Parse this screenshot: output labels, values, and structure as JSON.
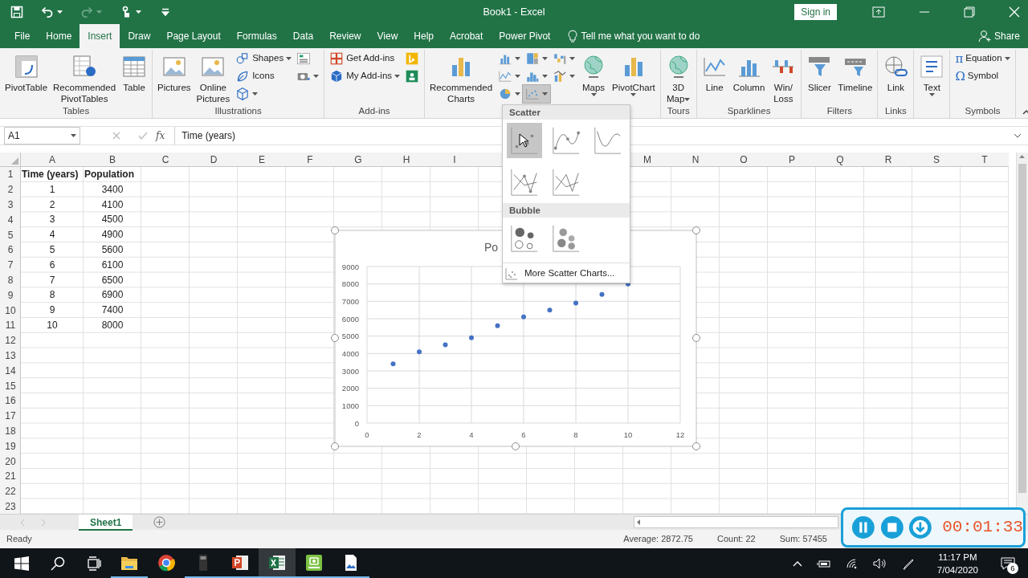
{
  "window": {
    "title": "Book1 - Excel",
    "sign_in": "Sign in"
  },
  "quick_access": [
    {
      "kind": "save",
      "dropdown": false,
      "disabled": false
    },
    {
      "kind": "undo",
      "dropdown": true,
      "disabled": false
    },
    {
      "kind": "redo",
      "dropdown": true,
      "disabled": true
    },
    {
      "kind": "touch",
      "dropdown": true,
      "disabled": false
    },
    {
      "kind": "customize",
      "dropdown": false,
      "disabled": false
    }
  ],
  "tabs": [
    {
      "label": "File",
      "selected": false
    },
    {
      "label": "Home",
      "selected": false
    },
    {
      "label": "Insert",
      "selected": true
    },
    {
      "label": "Draw",
      "selected": false
    },
    {
      "label": "Page Layout",
      "selected": false
    },
    {
      "label": "Formulas",
      "selected": false
    },
    {
      "label": "Data",
      "selected": false
    },
    {
      "label": "Review",
      "selected": false
    },
    {
      "label": "View",
      "selected": false
    },
    {
      "label": "Help",
      "selected": false
    },
    {
      "label": "Acrobat",
      "selected": false
    },
    {
      "label": "Power Pivot",
      "selected": false
    }
  ],
  "tell_me": "Tell me what you want to do",
  "share": "Share",
  "ribbon": {
    "groups": [
      {
        "label": "Tables",
        "items": [
          {
            "kind": "large",
            "label": "PivotTable",
            "dropdown": false
          },
          {
            "kind": "large",
            "label": "Recommended\nPivotTables",
            "dropdown": false
          },
          {
            "kind": "large",
            "label": "Table",
            "dropdown": false
          }
        ]
      },
      {
        "label": "Illustrations",
        "items": [
          {
            "kind": "large",
            "label": "Pictures",
            "dropdown": false
          },
          {
            "kind": "large",
            "label": "Online\nPictures",
            "dropdown": false
          },
          {
            "kind": "small",
            "label": "Shapes",
            "dropdown": true
          },
          {
            "kind": "small",
            "label": "Icons",
            "dropdown": false
          },
          {
            "kind": "icon",
            "dropdown": true
          },
          {
            "kind": "icon",
            "dropdown": false
          },
          {
            "kind": "icon",
            "dropdown": true
          }
        ]
      },
      {
        "label": "Add-ins",
        "items": [
          {
            "kind": "small",
            "label": "Get Add-ins",
            "dropdown": false
          },
          {
            "kind": "small",
            "label": "My Add-ins",
            "dropdown": true
          },
          {
            "kind": "icon",
            "dropdown": false
          },
          {
            "kind": "icon",
            "dropdown": false
          }
        ]
      },
      {
        "items": [
          {
            "kind": "large",
            "label": "Recommended\nCharts",
            "dropdown": false,
            "expanded": false
          },
          {
            "kind": "icon",
            "dropdown": true,
            "expanded": false
          },
          {
            "kind": "icon",
            "dropdown": true,
            "expanded": false
          },
          {
            "kind": "icon",
            "dropdown": true,
            "expanded": false
          },
          {
            "kind": "icon",
            "dropdown": true,
            "expanded": false
          },
          {
            "kind": "icon",
            "dropdown": true,
            "expanded": false
          },
          {
            "kind": "icon",
            "dropdown": true,
            "expanded": true
          },
          {
            "kind": "icon",
            "dropdown": true,
            "expanded": false
          },
          {
            "kind": "icon",
            "dropdown": true,
            "expanded": false
          },
          {
            "kind": "large",
            "label": "Maps",
            "dropdown": true,
            "expanded": false
          },
          {
            "kind": "large",
            "label": "PivotChart",
            "dropdown": true,
            "expanded": false
          }
        ]
      },
      {
        "label": "Tours",
        "items": [
          {
            "kind": "large",
            "label": "3D\nMap",
            "dropdown": true
          }
        ]
      },
      {
        "label": "Sparklines",
        "items": [
          {
            "kind": "large",
            "label": "Line",
            "dropdown": false
          },
          {
            "kind": "large",
            "label": "Column",
            "dropdown": false
          },
          {
            "kind": "large",
            "label": "Win/\nLoss",
            "dropdown": false
          }
        ]
      },
      {
        "label": "Filters",
        "items": [
          {
            "kind": "large",
            "label": "Slicer",
            "dropdown": false
          },
          {
            "kind": "large",
            "label": "Timeline",
            "dropdown": false
          }
        ]
      },
      {
        "label": "Links",
        "items": [
          {
            "kind": "large",
            "label": "Link",
            "dropdown": false
          }
        ]
      },
      {
        "items": [
          {
            "kind": "large",
            "label": "Text",
            "dropdown": true
          }
        ]
      },
      {
        "label": "Symbols",
        "items": [
          {
            "kind": "small",
            "glyph": "π",
            "label": "Equation",
            "dropdown": true
          },
          {
            "kind": "small",
            "glyph": "Ω",
            "label": "Symbol",
            "dropdown": false
          }
        ]
      }
    ]
  },
  "formula_bar": {
    "name_box": "A1",
    "function_label": "fx",
    "formula": "Time (years)"
  },
  "sheet": {
    "columns": [
      "A",
      "B",
      "C",
      "D",
      "E",
      "F",
      "G",
      "H",
      "I",
      null,
      null,
      null,
      "M",
      "N",
      "O",
      "P",
      "Q",
      "R",
      "S",
      "T"
    ],
    "rows": [
      {
        "header": "1",
        "kind": "header",
        "cells": [
          "Time (years)",
          "Population"
        ]
      },
      {
        "header": "2",
        "kind": "data",
        "cells": [
          "1",
          "3400"
        ]
      },
      {
        "header": "3",
        "kind": "data",
        "cells": [
          "2",
          "4100"
        ]
      },
      {
        "header": "4",
        "kind": "data",
        "cells": [
          "3",
          "4500"
        ]
      },
      {
        "header": "5",
        "kind": "data",
        "cells": [
          "4",
          "4900"
        ]
      },
      {
        "header": "6",
        "kind": "data",
        "cells": [
          "5",
          "5600"
        ]
      },
      {
        "header": "7",
        "kind": "data",
        "cells": [
          "6",
          "6100"
        ]
      },
      {
        "header": "8",
        "kind": "data",
        "cells": [
          "7",
          "6500"
        ]
      },
      {
        "header": "9",
        "kind": "data",
        "cells": [
          "8",
          "6900"
        ]
      },
      {
        "header": "10",
        "kind": "data",
        "cells": [
          "9",
          "7400"
        ]
      },
      {
        "header": "11",
        "kind": "data",
        "cells": [
          "10",
          "8000"
        ]
      },
      {
        "header": "12"
      },
      {
        "header": "13"
      },
      {
        "header": "14"
      },
      {
        "header": "15"
      },
      {
        "header": "16"
      },
      {
        "header": "17"
      },
      {
        "header": "18"
      },
      {
        "header": "19"
      },
      {
        "header": "20"
      },
      {
        "header": "21"
      },
      {
        "header": "22"
      },
      {
        "header": "23"
      }
    ]
  },
  "chart": {
    "chart_data": {
      "type": "scatter",
      "title": "Po",
      "grid": true,
      "x": [
        1,
        2,
        3,
        4,
        5,
        6,
        7,
        8,
        9,
        10
      ],
      "series": [
        {
          "color": "#4472c4",
          "values": [
            3400,
            4100,
            4500,
            4900,
            5600,
            6100,
            6500,
            6900,
            7400,
            8000
          ]
        }
      ],
      "xlim": [
        0,
        12
      ],
      "ylim": [
        0,
        9000
      ],
      "xticks": [
        0,
        2,
        4,
        6,
        8,
        10,
        12
      ],
      "yticks": [
        0,
        1000,
        2000,
        3000,
        4000,
        5000,
        6000,
        7000,
        8000,
        9000
      ]
    }
  },
  "scatter_menu": {
    "sections": [
      {
        "title": "Scatter",
        "options": [
          {
            "selected": true
          },
          {
            "selected": false
          },
          {
            "selected": false
          },
          {
            "selected": false
          },
          {
            "selected": false
          }
        ]
      },
      {
        "title": "Bubble",
        "options": [
          {
            "selected": false
          },
          {
            "selected": false
          }
        ]
      }
    ],
    "more": "More Scatter Charts..."
  },
  "sheet_tabs": [
    {
      "label": "Sheet1",
      "selected": true
    }
  ],
  "status_bar": {
    "mode": "Ready",
    "stats": [
      "Average: 2872.75",
      "Count: 22",
      "Sum: 57455"
    ]
  },
  "recorder": {
    "time": "00:01:33"
  },
  "taskbar": {
    "apps": [
      {
        "running": true,
        "selected": false
      },
      {
        "running": false,
        "selected": false
      },
      {
        "running": true,
        "selected": false
      },
      {
        "running": true,
        "selected": false
      },
      {
        "running": true,
        "selected": true
      },
      {
        "running": true,
        "selected": false
      },
      {
        "running": true,
        "selected": false
      }
    ],
    "time": "11:17 PM",
    "date": "7/04/2020",
    "notifications": "6"
  }
}
